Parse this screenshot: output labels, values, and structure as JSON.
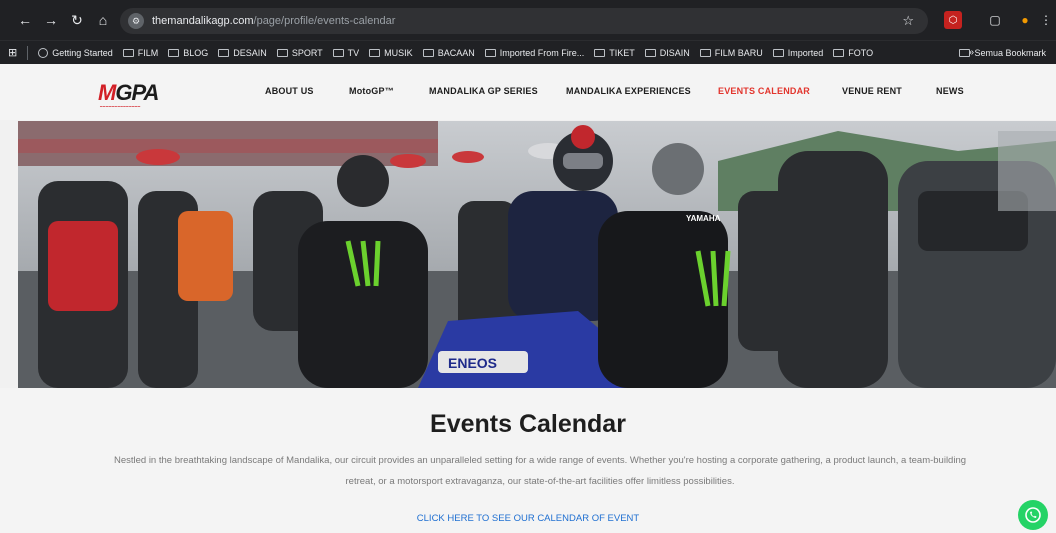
{
  "browser": {
    "url_host": "themandalikagp.com",
    "url_path": "/page/profile/events-calendar",
    "bookmarks": [
      "Getting Started",
      "FILM",
      "BLOG",
      "DESAIN",
      "SPORT",
      "TV",
      "MUSIK",
      "BACAAN",
      "Imported From Fire...",
      "TIKET",
      "DISAIN",
      "FILM BARU",
      "Imported",
      "FOTO"
    ],
    "all_bookmarks": "Semua Bookmark",
    "more_chevron": "»"
  },
  "site": {
    "logo": "MGPA",
    "nav": [
      {
        "label": "ABOUT US",
        "active": false
      },
      {
        "label": "MotoGP™",
        "active": false
      },
      {
        "label": "MANDALIKA GP SERIES",
        "active": false
      },
      {
        "label": "MANDALIKA EXPERIENCES",
        "active": false
      },
      {
        "label": "EVENTS CALENDAR",
        "active": true
      },
      {
        "label": "VENUE RENT",
        "active": false
      },
      {
        "label": "NEWS",
        "active": false
      }
    ]
  },
  "hero": {
    "bike_text": "ENEOS",
    "shirt_text": "YAMAHA"
  },
  "content": {
    "title": "Events Calendar",
    "description": "Nestled in the breathtaking landscape of Mandalika, our circuit provides an unparalleled setting for a wide range of events. Whether you're hosting a corporate gathering, a product launch, a team-building retreat, or a motorsport extravaganza, our state-of-the-art facilities offer limitless possibilities.",
    "cta": "CLICK HERE TO SEE OUR CALENDAR OF EVENT"
  },
  "colors": {
    "accent_red": "#e2352d",
    "link_blue": "#1f6fd1",
    "whatsapp_green": "#25d366",
    "chrome_dark": "#202124"
  }
}
